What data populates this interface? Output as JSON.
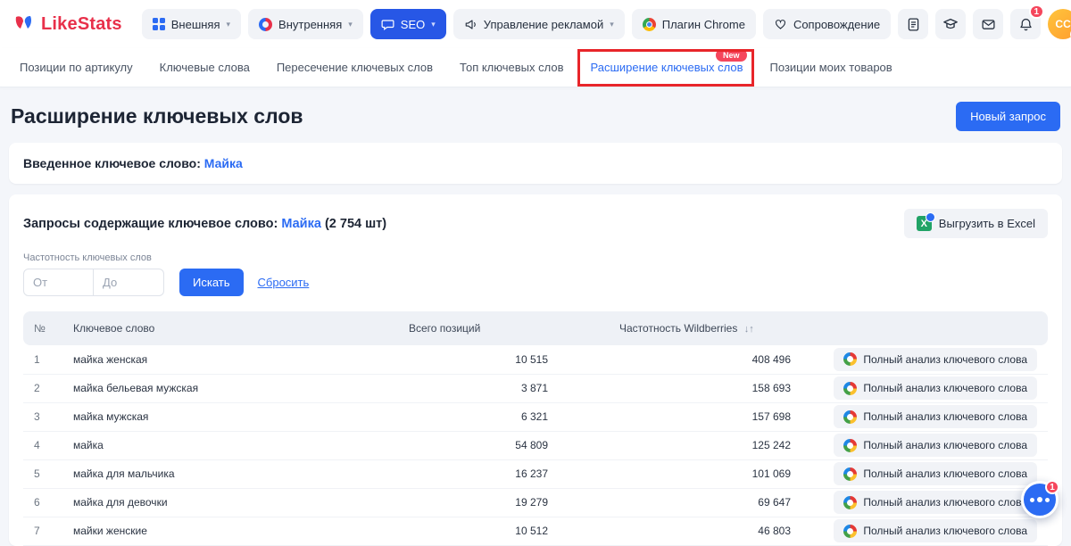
{
  "topbar": {
    "logo": "LikeStats",
    "nav": [
      {
        "label": "Внешняя"
      },
      {
        "label": "Внутренняя"
      },
      {
        "label": "SEO"
      },
      {
        "label": "Управление рекламой"
      },
      {
        "label": "Плагин Chrome"
      },
      {
        "label": "Сопровождение"
      }
    ],
    "bell_badge": "1",
    "avatar_initials": "CC"
  },
  "tabs": [
    {
      "label": "Позиции по артикулу"
    },
    {
      "label": "Ключевые слова"
    },
    {
      "label": "Пересечение ключевых слов"
    },
    {
      "label": "Топ ключевых слов"
    },
    {
      "label": "Расширение ключевых слов",
      "badge": "New"
    },
    {
      "label": "Позиции моих товаров"
    }
  ],
  "page": {
    "title": "Расширение ключевых слов",
    "new_request_button": "Новый запрос"
  },
  "entered_keyword": {
    "label": "Введенное ключевое слово:",
    "value": "Майка"
  },
  "results": {
    "heading_prefix": "Запросы содержащие ключевое слово:",
    "keyword": "Майка",
    "count": "(2 754 шт)",
    "export_button": "Выгрузить в Excel",
    "filter_label": "Частотность ключевых слов",
    "from_placeholder": "От",
    "to_placeholder": "До",
    "search_button": "Искать",
    "reset_button": "Сбросить",
    "table": {
      "headers": {
        "num": "№",
        "keyword": "Ключевое слово",
        "positions": "Всего позиций",
        "frequency": "Частотность Wildberries"
      },
      "sort_icon": "↓↑",
      "action_label": "Полный анализ ключевого слова",
      "rows": [
        {
          "num": "1",
          "keyword": "майка женская",
          "positions": "10 515",
          "frequency": "408 496"
        },
        {
          "num": "2",
          "keyword": "майка бельевая мужская",
          "positions": "3 871",
          "frequency": "158 693"
        },
        {
          "num": "3",
          "keyword": "майка мужская",
          "positions": "6 321",
          "frequency": "157 698"
        },
        {
          "num": "4",
          "keyword": "майка",
          "positions": "54 809",
          "frequency": "125 242"
        },
        {
          "num": "5",
          "keyword": "майка для мальчика",
          "positions": "16 237",
          "frequency": "101 069"
        },
        {
          "num": "6",
          "keyword": "майка для девочки",
          "positions": "19 279",
          "frequency": "69 647"
        },
        {
          "num": "7",
          "keyword": "майки женские",
          "positions": "10 512",
          "frequency": "46 803"
        }
      ]
    }
  },
  "chat": {
    "badge": "1"
  },
  "colors": {
    "accent": "#2b6bf3",
    "seo_active": "#2757e6",
    "danger": "#f5465c",
    "annotation": "#e8252a"
  }
}
